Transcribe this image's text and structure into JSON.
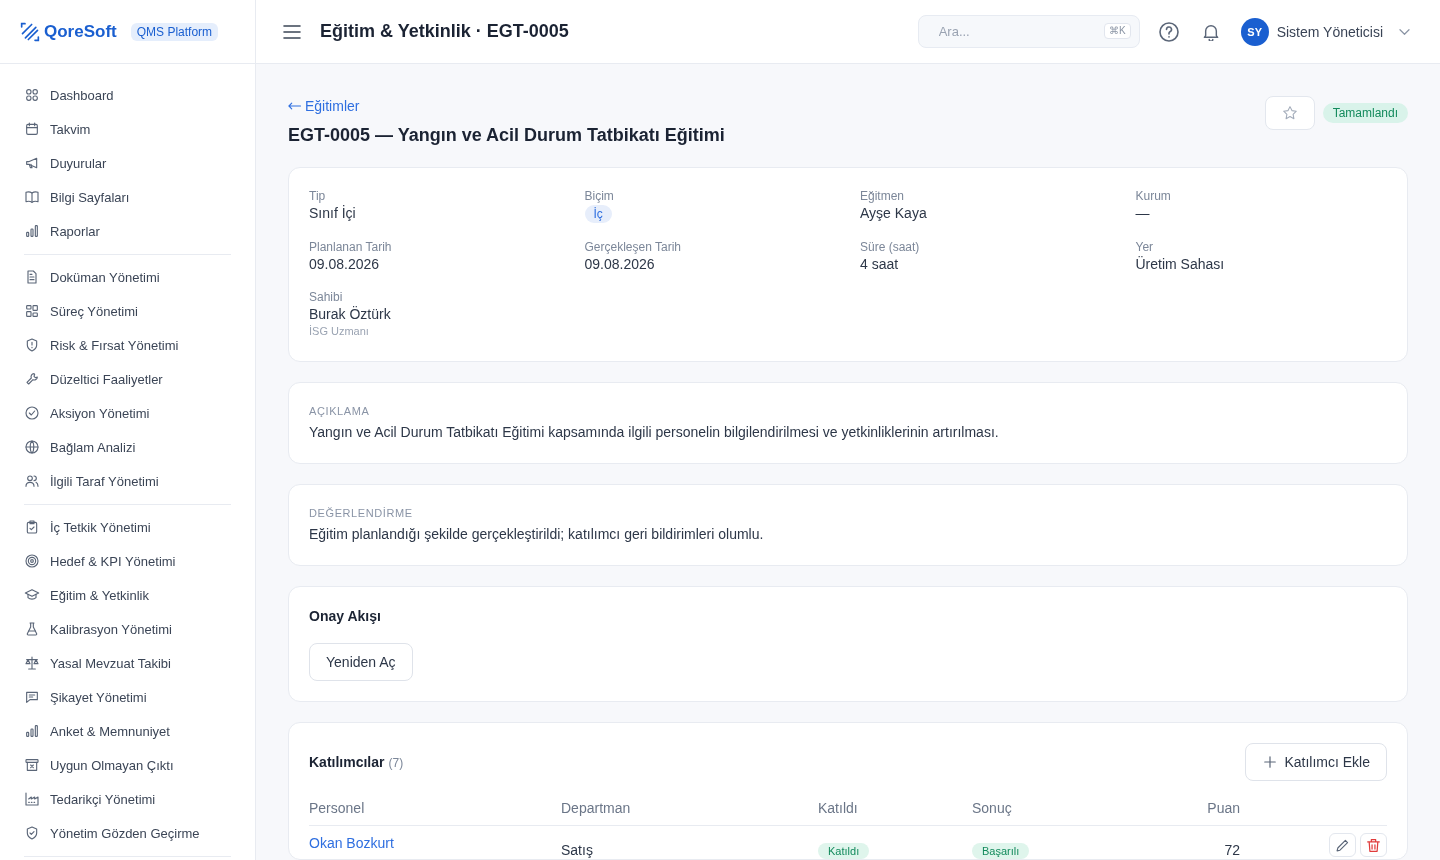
{
  "brand": {
    "name": "QoreSoft",
    "badge": "QMS Platform"
  },
  "sidebar": {
    "groups": [
      {
        "items": [
          {
            "label": "Dashboard"
          },
          {
            "label": "Takvim"
          },
          {
            "label": "Duyurular"
          },
          {
            "label": "Bilgi Sayfaları"
          },
          {
            "label": "Raporlar"
          }
        ]
      },
      {
        "items": [
          {
            "label": "Doküman Yönetimi"
          },
          {
            "label": "Süreç Yönetimi"
          },
          {
            "label": "Risk & Fırsat Yönetimi"
          },
          {
            "label": "Düzeltici Faaliyetler"
          },
          {
            "label": "Aksiyon Yönetimi"
          },
          {
            "label": "Bağlam Analizi"
          },
          {
            "label": "İlgili Taraf Yönetimi"
          }
        ]
      },
      {
        "items": [
          {
            "label": "İç Tetkik Yönetimi"
          },
          {
            "label": "Hedef & KPI Yönetimi"
          },
          {
            "label": "Eğitim & Yetkinlik"
          },
          {
            "label": "Kalibrasyon Yönetimi"
          },
          {
            "label": "Yasal Mevzuat Takibi"
          },
          {
            "label": "Şikayet Yönetimi"
          },
          {
            "label": "Anket & Memnuniyet"
          },
          {
            "label": "Uygun Olmayan Çıktı"
          },
          {
            "label": "Tedarikçi Yönetimi"
          },
          {
            "label": "Yönetim Gözden Geçirme"
          }
        ]
      }
    ]
  },
  "header": {
    "title": "Eğitim & Yetkinlik · EGT-0005",
    "search": {
      "placeholder": "Ara...",
      "shortcut": "⌘K"
    },
    "user": {
      "initials": "SY",
      "name": "Sistem Yöneticisi"
    }
  },
  "page": {
    "back_link": "Eğitimler",
    "title": "EGT-0005 — Yangın ve Acil Durum Tatbikatı Eğitimi",
    "starred": false,
    "status": "Tamamlandı"
  },
  "details": [
    {
      "label": "Tip",
      "value": "Sınıf İçi",
      "kind": "text"
    },
    {
      "label": "Biçim",
      "value": "İç",
      "kind": "tag"
    },
    {
      "label": "Eğitmen",
      "value": "Ayşe Kaya",
      "kind": "text"
    },
    {
      "label": "Kurum",
      "value": "—",
      "kind": "text"
    },
    {
      "label": "Planlanan Tarih",
      "value": "09.08.2026",
      "kind": "text"
    },
    {
      "label": "Gerçekleşen Tarih",
      "value": "09.08.2026",
      "kind": "text"
    },
    {
      "label": "Süre (saat)",
      "value": "4 saat",
      "kind": "text"
    },
    {
      "label": "Yer",
      "value": "Üretim Sahası",
      "kind": "text"
    },
    {
      "label": "Sahibi",
      "value": "Burak Öztürk",
      "kind": "text",
      "note": "İSG Uzmanı"
    }
  ],
  "notes": [
    {
      "heading": "AÇIKLAMA",
      "text": "Yangın ve Acil Durum Tatbikatı Eğitimi kapsamında ilgili personelin bilgilendirilmesi ve yetkinliklerinin artırılması."
    },
    {
      "heading": "DEĞERLENDİRME",
      "text": "Eğitim planlandığı şekilde gerçekleştirildi; katılımcı geri bildirimleri olumlu."
    }
  ],
  "approval": {
    "heading": "Onay Akışı",
    "buttons": [
      "Yeniden Aç"
    ]
  },
  "participants": {
    "heading": "Katılımcılar",
    "count": "(7)",
    "add_button": "Katılımcı Ekle",
    "columns": [
      "Personel",
      "Departman",
      "Katıldı",
      "Sonuç",
      "Puan"
    ],
    "rows": [
      {
        "name": "Okan Bozkurt",
        "department": "Satış",
        "attended": "Katıldı",
        "result": "Başarılı",
        "score": "72"
      }
    ]
  }
}
